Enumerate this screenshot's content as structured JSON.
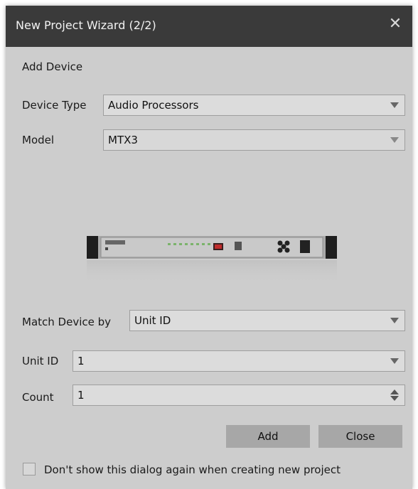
{
  "window": {
    "title": "New Project Wizard (2/2)",
    "close_icon": "close-icon"
  },
  "section": {
    "heading": "Add Device"
  },
  "device_type": {
    "label": "Device Type",
    "value": "Audio Processors"
  },
  "model": {
    "label": "Model",
    "value": "MTX3"
  },
  "match_device": {
    "label": "Match Device by",
    "value": "Unit ID"
  },
  "unit_id": {
    "label": "Unit ID",
    "value": "1"
  },
  "count": {
    "label": "Count",
    "value": "1"
  },
  "buttons": {
    "add": "Add",
    "close": "Close"
  },
  "dont_show": {
    "label": "Don't show this dialog again when creating new project",
    "checked": false
  }
}
